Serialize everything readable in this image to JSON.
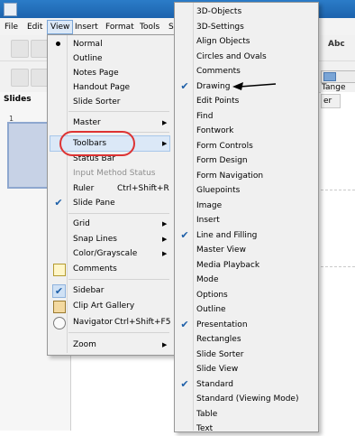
{
  "menubar": {
    "items": [
      "File",
      "Edit",
      "View",
      "Insert",
      "Format",
      "Tools",
      "S"
    ],
    "active": "View"
  },
  "toolbar": {
    "abc_label": "Abc",
    "tange_label": "Tange"
  },
  "slides_panel": {
    "title": "Slides",
    "slide_number": "1"
  },
  "workarea": {
    "tab_label": "er"
  },
  "view_menu": {
    "items": [
      {
        "label": "Normal",
        "mark": "bullet"
      },
      {
        "label": "Outline"
      },
      {
        "label": "Notes Page"
      },
      {
        "label": "Handout Page"
      },
      {
        "label": "Slide Sorter"
      },
      {
        "label": "Master",
        "submenu": true
      },
      {
        "label": "Toolbars",
        "submenu": true,
        "highlighted": true
      },
      {
        "label": "Status Bar"
      },
      {
        "label": "Input Method Status",
        "disabled": true
      },
      {
        "label": "Ruler",
        "shortcut": "Ctrl+Shift+R"
      },
      {
        "label": "Slide Pane",
        "mark": "check"
      },
      {
        "label": "Grid",
        "submenu": true
      },
      {
        "label": "Snap Lines",
        "submenu": true
      },
      {
        "label": "Color/Grayscale",
        "submenu": true
      },
      {
        "label": "Comments",
        "icon": "comments-icon"
      },
      {
        "label": "Sidebar",
        "mark": "check-boxed"
      },
      {
        "label": "Clip Art Gallery",
        "icon": "gallery-icon"
      },
      {
        "label": "Navigator",
        "shortcut": "Ctrl+Shift+F5",
        "icon": "navigator-icon"
      },
      {
        "label": "Zoom",
        "submenu": true
      }
    ]
  },
  "toolbars_submenu": {
    "items": [
      {
        "label": "3D-Objects"
      },
      {
        "label": "3D-Settings"
      },
      {
        "label": "Align Objects"
      },
      {
        "label": "Circles and Ovals"
      },
      {
        "label": "Comments"
      },
      {
        "label": "Drawing",
        "checked": true
      },
      {
        "label": "Edit Points"
      },
      {
        "label": "Find"
      },
      {
        "label": "Fontwork"
      },
      {
        "label": "Form Controls"
      },
      {
        "label": "Form Design"
      },
      {
        "label": "Form Navigation"
      },
      {
        "label": "Gluepoints"
      },
      {
        "label": "Image"
      },
      {
        "label": "Insert"
      },
      {
        "label": "Line and Filling",
        "checked": true
      },
      {
        "label": "Master View"
      },
      {
        "label": "Media Playback"
      },
      {
        "label": "Mode"
      },
      {
        "label": "Options"
      },
      {
        "label": "Outline"
      },
      {
        "label": "Presentation",
        "checked": true
      },
      {
        "label": "Rectangles"
      },
      {
        "label": "Slide Sorter"
      },
      {
        "label": "Slide View"
      },
      {
        "label": "Standard",
        "checked": true
      },
      {
        "label": "Standard (Viewing Mode)"
      },
      {
        "label": "Table"
      },
      {
        "label": "Text"
      }
    ]
  },
  "colors": {
    "highlight": "#dbe8f7",
    "check": "#1d5fa8",
    "annotation": "#dd3333"
  }
}
